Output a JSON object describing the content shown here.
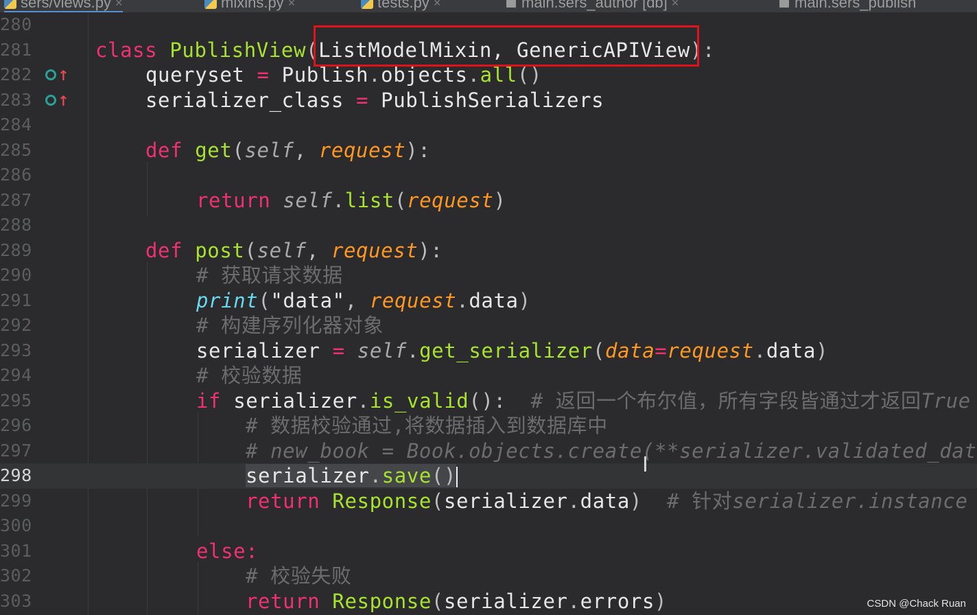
{
  "tabs": [
    {
      "label": "sers/views.py",
      "icon": "python-file-icon"
    },
    {
      "label": "mixins.py",
      "icon": "python-file-icon"
    },
    {
      "label": "tests.py",
      "icon": "python-file-icon"
    },
    {
      "label": "main.sers_author [db]",
      "icon": "table-icon"
    },
    {
      "label": "main.sers_publish",
      "icon": "table-icon"
    }
  ],
  "editor": {
    "current_line": "298",
    "lines": [
      {
        "n": "280"
      },
      {
        "n": "281",
        "t": {
          "kw": "class",
          "name": "PublishView",
          "p1": "(",
          "bases": "ListModelMixin, GenericAPIView",
          "p2": "):"
        }
      },
      {
        "n": "282",
        "t": {
          "a": "queryset",
          "eq": "=",
          "b": "Publish",
          "dot": ".",
          "c": "objects",
          "dot2": ".",
          "d": "all",
          "e": "()"
        }
      },
      {
        "n": "283",
        "t": {
          "a": "serializer_class",
          "eq": "=",
          "b": "PublishSerializers"
        }
      },
      {
        "n": "284"
      },
      {
        "n": "285",
        "t": {
          "kw": "def",
          "name": "get",
          "p1": "(",
          "self": "self",
          "comma": ", ",
          "param": "request",
          "p2": "):"
        }
      },
      {
        "n": "286"
      },
      {
        "n": "287",
        "t": {
          "kw": "return",
          "self": "self",
          "dot": ".",
          "name": "list",
          "p1": "(",
          "param": "request",
          "p2": ")"
        }
      },
      {
        "n": "288"
      },
      {
        "n": "289",
        "t": {
          "kw": "def",
          "name": "post",
          "p1": "(",
          "self": "self",
          "comma": ", ",
          "param": "request",
          "p2": "):"
        }
      },
      {
        "n": "290",
        "t": {
          "cmt": "# 获取请求数据"
        }
      },
      {
        "n": "291",
        "t": {
          "builtin": "print",
          "p1": "(",
          "str": "\"data\"",
          "comma": ", ",
          "param": "request",
          "dot": ".",
          "attr": "data",
          "p2": ")"
        }
      },
      {
        "n": "292",
        "t": {
          "cmt": "# 构建序列化器对象"
        }
      },
      {
        "n": "293",
        "t": {
          "a": "serializer",
          "eq": "=",
          "self": "self",
          "dot": ".",
          "name": "get_serializer",
          "p1": "(",
          "param": "data",
          "eq2": "=",
          "param2": "request",
          "dot2": ".",
          "attr": "data",
          "p2": ")"
        }
      },
      {
        "n": "294",
        "t": {
          "cmt": "# 校验数据"
        }
      },
      {
        "n": "295",
        "t": {
          "kw": "if",
          "a": "serializer",
          "dot": ".",
          "name": "is_valid",
          "p": "():",
          "cmt": "# 返回一个布尔值，所有字段皆通过才返回",
          "cmt_it": "True"
        }
      },
      {
        "n": "296",
        "t": {
          "cmt": "# 数据校验通过,将数据插入到数据库中"
        }
      },
      {
        "n": "297",
        "t": {
          "cmt_it": "# new_book = Book.objects.create(**serializer.validated_dat"
        }
      },
      {
        "n": "298",
        "t": {
          "a": "serializer",
          "dot": ".",
          "name": "save",
          "p": "()"
        }
      },
      {
        "n": "299",
        "t": {
          "kw": "return",
          "name": "Response",
          "p1": "(",
          "a": "serializer",
          "dot": ".",
          "attr": "data",
          "p2": ")",
          "cmt": "# 针对",
          "cmt_it": "serializer.instance"
        }
      },
      {
        "n": "300"
      },
      {
        "n": "301",
        "t": {
          "kw": "else:"
        }
      },
      {
        "n": "302",
        "t": {
          "cmt": "# 校验失败"
        }
      },
      {
        "n": "303",
        "t": {
          "kw": "return",
          "name": "Response",
          "p1": "(",
          "a": "serializer",
          "dot": ".",
          "attr": "errors",
          "p2": ")"
        }
      }
    ]
  },
  "watermark": "CSDN @Chack Ruan",
  "colors": {
    "keyword": "#f0306f",
    "function": "#a6e22e",
    "param": "#fd971f",
    "builtin": "#66d9ef",
    "comment": "#6c6c6c",
    "highlight_box": "#e0121b",
    "background": "#2b2b2d"
  }
}
